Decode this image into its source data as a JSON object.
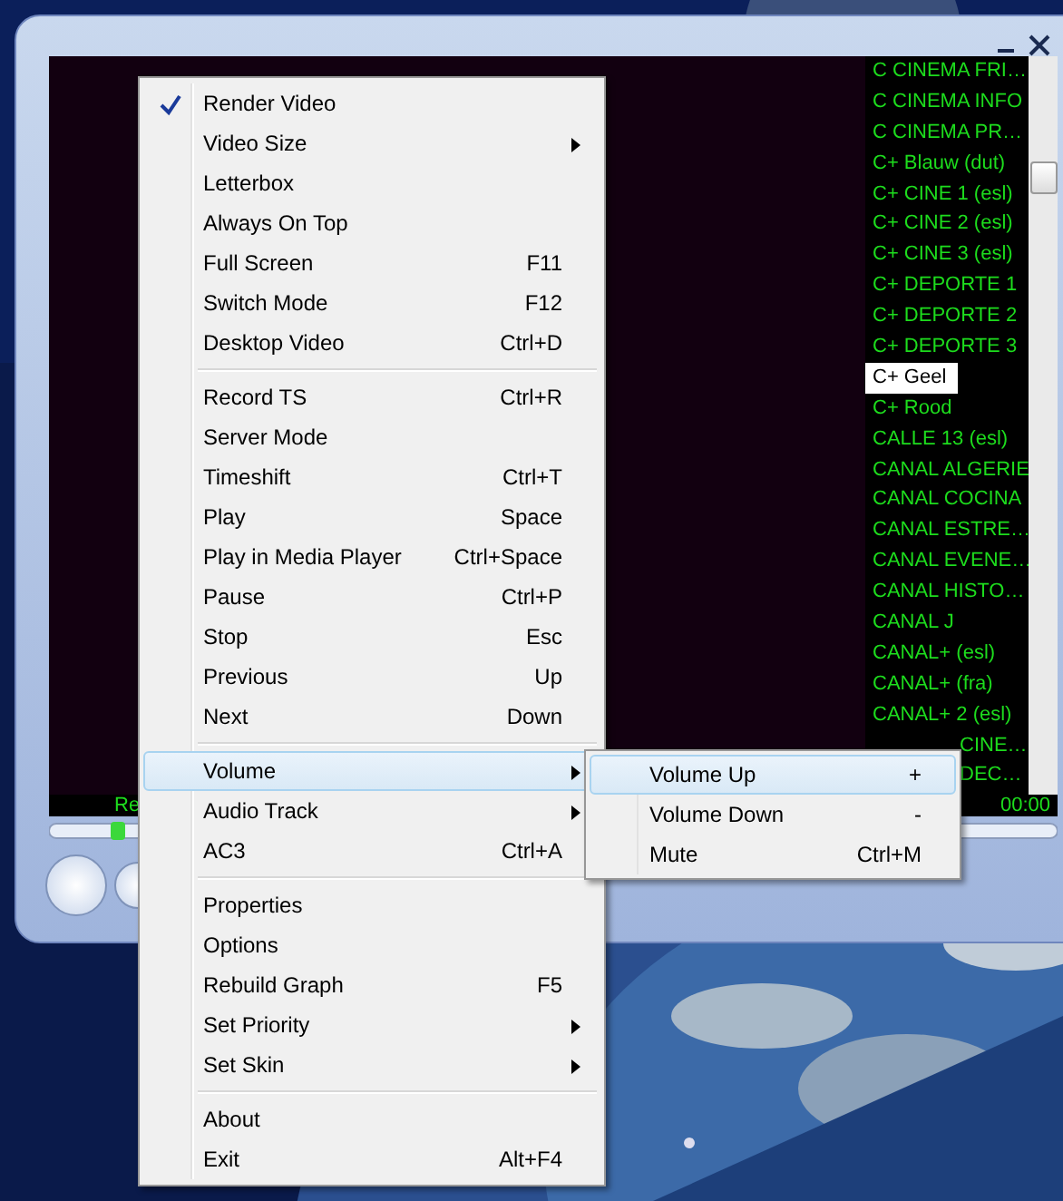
{
  "player": {
    "status_text": "Re",
    "time": "00:00",
    "channels": [
      {
        "name": "C CINEMA FRI…",
        "selected": false
      },
      {
        "name": "C CINEMA INFO",
        "selected": false
      },
      {
        "name": "C CINEMA PR…",
        "selected": false
      },
      {
        "name": "C+ Blauw (dut)",
        "selected": false
      },
      {
        "name": "C+ CINE 1 (esl)",
        "selected": false
      },
      {
        "name": "C+ CINE 2 (esl)",
        "selected": false
      },
      {
        "name": "C+ CINE 3 (esl)",
        "selected": false
      },
      {
        "name": "C+ DEPORTE 1",
        "selected": false
      },
      {
        "name": "C+ DEPORTE 2",
        "selected": false
      },
      {
        "name": "C+ DEPORTE 3",
        "selected": false
      },
      {
        "name": "C+ Geel",
        "selected": true
      },
      {
        "name": "C+ Rood",
        "selected": false
      },
      {
        "name": "CALLE 13 (esl)",
        "selected": false
      },
      {
        "name": "CANAL ALGERIE",
        "selected": false
      },
      {
        "name": "CANAL COCINA",
        "selected": false
      },
      {
        "name": "CANAL ESTRE…",
        "selected": false
      },
      {
        "name": "CANAL EVENE…",
        "selected": false
      },
      {
        "name": "CANAL HISTO…",
        "selected": false
      },
      {
        "name": "CANAL J",
        "selected": false
      },
      {
        "name": "CANAL+ (esl)",
        "selected": false
      },
      {
        "name": "CANAL+ (fra)",
        "selected": false
      },
      {
        "name": "CANAL+ 2 (esl)",
        "selected": false
      },
      {
        "name": "CINE…",
        "selected": false
      },
      {
        "name": "DEC…",
        "selected": false
      }
    ]
  },
  "context_menu": {
    "items": [
      {
        "kind": "item",
        "label": "Render Video",
        "checked": true,
        "submenu": false,
        "selected": false
      },
      {
        "kind": "item",
        "label": "Video Size",
        "checked": false,
        "submenu": true,
        "selected": false
      },
      {
        "kind": "item",
        "label": "Letterbox",
        "checked": false,
        "submenu": false,
        "selected": false
      },
      {
        "kind": "item",
        "label": "Always On Top",
        "checked": false,
        "submenu": false,
        "selected": false
      },
      {
        "kind": "item",
        "label": "Full Screen",
        "shortcut": "F11",
        "checked": false,
        "submenu": false,
        "selected": false
      },
      {
        "kind": "item",
        "label": "Switch Mode",
        "shortcut": "F12",
        "checked": false,
        "submenu": false,
        "selected": false
      },
      {
        "kind": "item",
        "label": "Desktop Video",
        "shortcut": "Ctrl+D",
        "checked": false,
        "submenu": false,
        "selected": false
      },
      {
        "kind": "separator"
      },
      {
        "kind": "item",
        "label": "Record TS",
        "shortcut": "Ctrl+R",
        "checked": false,
        "submenu": false,
        "selected": false
      },
      {
        "kind": "item",
        "label": "Server Mode",
        "checked": false,
        "submenu": false,
        "selected": false
      },
      {
        "kind": "item",
        "label": "Timeshift",
        "shortcut": "Ctrl+T",
        "checked": false,
        "submenu": false,
        "selected": false
      },
      {
        "kind": "item",
        "label": "Play",
        "shortcut": "Space",
        "checked": false,
        "submenu": false,
        "selected": false
      },
      {
        "kind": "item",
        "label": "Play in Media Player",
        "shortcut": "Ctrl+Space",
        "checked": false,
        "submenu": false,
        "selected": false
      },
      {
        "kind": "item",
        "label": "Pause",
        "shortcut": "Ctrl+P",
        "checked": false,
        "submenu": false,
        "selected": false
      },
      {
        "kind": "item",
        "label": "Stop",
        "shortcut": "Esc",
        "checked": false,
        "submenu": false,
        "selected": false
      },
      {
        "kind": "item",
        "label": "Previous",
        "shortcut": "Up",
        "checked": false,
        "submenu": false,
        "selected": false
      },
      {
        "kind": "item",
        "label": "Next",
        "shortcut": "Down",
        "checked": false,
        "submenu": false,
        "selected": false
      },
      {
        "kind": "separator"
      },
      {
        "kind": "item",
        "label": "Volume",
        "checked": false,
        "submenu": true,
        "selected": true
      },
      {
        "kind": "item",
        "label": "Audio Track",
        "checked": false,
        "submenu": true,
        "selected": false
      },
      {
        "kind": "item",
        "label": "AC3",
        "shortcut": "Ctrl+A",
        "checked": false,
        "submenu": false,
        "selected": false
      },
      {
        "kind": "separator"
      },
      {
        "kind": "item",
        "label": "Properties",
        "checked": false,
        "submenu": false,
        "selected": false
      },
      {
        "kind": "item",
        "label": "Options",
        "checked": false,
        "submenu": false,
        "selected": false
      },
      {
        "kind": "item",
        "label": "Rebuild Graph",
        "shortcut": "F5",
        "checked": false,
        "submenu": false,
        "selected": false
      },
      {
        "kind": "item",
        "label": "Set Priority",
        "checked": false,
        "submenu": true,
        "selected": false
      },
      {
        "kind": "item",
        "label": "Set Skin",
        "checked": false,
        "submenu": true,
        "selected": false
      },
      {
        "kind": "separator"
      },
      {
        "kind": "item",
        "label": "About",
        "checked": false,
        "submenu": false,
        "selected": false
      },
      {
        "kind": "item",
        "label": "Exit",
        "shortcut": "Alt+F4",
        "checked": false,
        "submenu": false,
        "selected": false
      }
    ]
  },
  "volume_submenu": {
    "items": [
      {
        "label": "Volume Up",
        "shortcut": "+",
        "selected": true
      },
      {
        "label": "Volume Down",
        "shortcut": "-",
        "selected": false
      },
      {
        "label": "Mute",
        "shortcut": "Ctrl+M",
        "selected": false
      }
    ]
  }
}
